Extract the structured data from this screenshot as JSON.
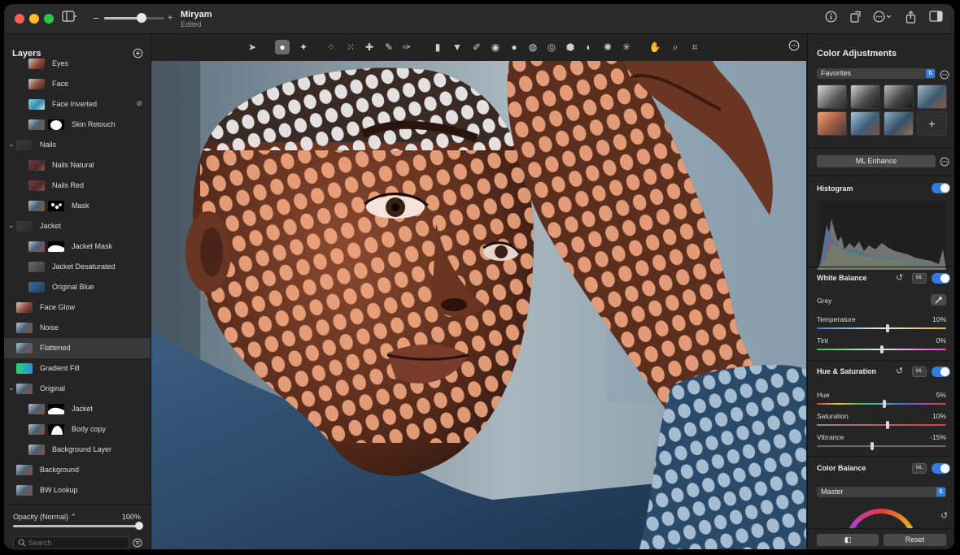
{
  "window": {
    "title": "Miryam",
    "subtitle": "Edited",
    "zoom_minus": "−",
    "zoom_plus": "+",
    "zoom_level": 0.62
  },
  "layers_panel": {
    "title": "Layers",
    "items": [
      {
        "name": "Eyes",
        "indent": 1,
        "thumb": "face",
        "mask": null,
        "chevron": false
      },
      {
        "name": "Face",
        "indent": 1,
        "thumb": "face",
        "mask": null,
        "chevron": false
      },
      {
        "name": "Face Inverted",
        "indent": 1,
        "thumb": "inverted",
        "mask": null,
        "chevron": false,
        "badge": "eye-slash-icon"
      },
      {
        "name": "Skin Retouch",
        "indent": 1,
        "thumb": "photo",
        "mask": "blob",
        "chevron": false
      },
      {
        "name": "Nails",
        "indent": 0,
        "thumb": "dark",
        "mask": null,
        "chevron": true
      },
      {
        "name": "Nails Natural",
        "indent": 1,
        "thumb": "red",
        "mask": null,
        "chevron": false
      },
      {
        "name": "Nails Red",
        "indent": 1,
        "thumb": "red",
        "mask": null,
        "chevron": false
      },
      {
        "name": "Mask",
        "indent": 1,
        "thumb": "photo",
        "mask": "dots",
        "chevron": false
      },
      {
        "name": "Jacket",
        "indent": 0,
        "thumb": "dark",
        "mask": null,
        "chevron": true
      },
      {
        "name": "Jacket Mask",
        "indent": 1,
        "thumb": "photo",
        "mask": "hill",
        "chevron": false
      },
      {
        "name": "Jacket Desaturated",
        "indent": 1,
        "thumb": "gray",
        "mask": null,
        "chevron": false
      },
      {
        "name": "Original Blue",
        "indent": 1,
        "thumb": "blue",
        "mask": null,
        "chevron": false
      },
      {
        "name": "Face Glow",
        "indent": 0,
        "thumb": "face",
        "mask": null,
        "chevron": false
      },
      {
        "name": "Noise",
        "indent": 0,
        "thumb": "photo",
        "mask": null,
        "chevron": false
      },
      {
        "name": "Flattened",
        "indent": 0,
        "thumb": "photo",
        "mask": null,
        "chevron": false,
        "selected": true
      },
      {
        "name": "Gradient Fill",
        "indent": 0,
        "thumb": "gradient",
        "mask": null,
        "chevron": false
      },
      {
        "name": "Original",
        "indent": 0,
        "thumb": "photo",
        "mask": null,
        "chevron": true
      },
      {
        "name": "Jacket",
        "indent": 1,
        "thumb": "photo",
        "mask": "hill",
        "chevron": false
      },
      {
        "name": "Body copy",
        "indent": 1,
        "thumb": "photo",
        "mask": "body",
        "chevron": false
      },
      {
        "name": "Background Layer",
        "indent": 1,
        "thumb": "photo",
        "mask": null,
        "chevron": false
      },
      {
        "name": "Background",
        "indent": 0,
        "thumb": "photo",
        "mask": null,
        "chevron": false
      },
      {
        "name": "BW Lookup",
        "indent": 0,
        "thumb": "photo",
        "mask": null,
        "chevron": false
      }
    ],
    "opacity_label": "Opacity (Normal) ⌃",
    "opacity_value": "100%",
    "opacity_fraction": 1.0,
    "search_placeholder": "Search"
  },
  "toolbar": {
    "tools": [
      {
        "name": "arrange-tool",
        "icon": "pointer-icon",
        "glyph": "➤",
        "active": false
      },
      {
        "name": "quick-selection-tool",
        "icon": "selection-brush-icon",
        "glyph": "●",
        "active": true
      },
      {
        "name": "magic-tool",
        "icon": "sparkle-icon",
        "glyph": "✦",
        "active": false
      },
      {
        "name": "retouch-tool",
        "icon": "dots-brush-icon",
        "glyph": "⁘",
        "active": false
      },
      {
        "name": "repair-tool",
        "icon": "scatter-icon",
        "glyph": "⁙",
        "active": false
      },
      {
        "name": "clone-tool",
        "icon": "band-aid-icon",
        "glyph": "✚",
        "active": false
      },
      {
        "name": "smudge-tool",
        "icon": "eraser-icon",
        "glyph": "✎",
        "active": false
      },
      {
        "name": "paint-tool",
        "icon": "brush-icon",
        "glyph": "✑",
        "active": false
      },
      {
        "name": "gradient-tool",
        "icon": "gradient-icon",
        "glyph": "▮",
        "active": false
      },
      {
        "name": "fill-tool",
        "icon": "bucket-icon",
        "glyph": "▼",
        "active": false
      },
      {
        "name": "pencil-tool",
        "icon": "pencil-icon",
        "glyph": "✐",
        "active": false
      },
      {
        "name": "sponge-tool",
        "icon": "sponge-icon",
        "glyph": "◉",
        "active": false
      },
      {
        "name": "darken-tool",
        "icon": "dark-circle-icon",
        "glyph": "●",
        "active": false
      },
      {
        "name": "blur-tool",
        "icon": "blur-icon",
        "glyph": "◍",
        "active": false
      },
      {
        "name": "sharpen-tool",
        "icon": "sharpen-icon",
        "glyph": "◎",
        "active": false
      },
      {
        "name": "adjust-tool",
        "icon": "shield-icon",
        "glyph": "⬢",
        "active": false
      },
      {
        "name": "contrast-tool",
        "icon": "half-circle-icon",
        "glyph": "◐",
        "active": false
      },
      {
        "name": "light-tool",
        "icon": "sun-icon",
        "glyph": "✺",
        "active": false
      },
      {
        "name": "noise-tool",
        "icon": "noise-icon",
        "glyph": "✳",
        "active": false
      },
      {
        "name": "hand-tool",
        "icon": "hand-icon",
        "glyph": "✋",
        "active": false
      },
      {
        "name": "zoom-tool",
        "icon": "magnifier-icon",
        "glyph": "⌕",
        "active": false
      },
      {
        "name": "crop-tool",
        "icon": "crop-icon",
        "glyph": "⌗",
        "active": false
      }
    ],
    "more": "⋯"
  },
  "adjustments": {
    "title": "Color Adjustments",
    "preset_select": "Favorites",
    "preset_add": "+",
    "ml_enhance": "ML Enhance",
    "histogram": {
      "title": "Histogram"
    },
    "white_balance": {
      "title": "White Balance",
      "ml": "ML",
      "grey_label": "Grey",
      "temperature_label": "Temperature",
      "temperature_value": "10%",
      "temperature_pos": 0.55,
      "tint_label": "Tint",
      "tint_value": "0%",
      "tint_pos": 0.5
    },
    "hue_saturation": {
      "title": "Hue & Saturation",
      "ml": "ML",
      "hue_label": "Hue",
      "hue_value": "5%",
      "hue_pos": 0.52,
      "saturation_label": "Saturation",
      "saturation_value": "10%",
      "saturation_pos": 0.55,
      "vibrance_label": "Vibrance",
      "vibrance_value": "-15%",
      "vibrance_pos": 0.43
    },
    "color_balance": {
      "title": "Color Balance",
      "ml": "ML",
      "mode_select": "Master"
    },
    "footer": {
      "compare_label": "◧",
      "reset_label": "Reset"
    }
  },
  "colors": {
    "accent": "#2f7de1",
    "panel": "#252525",
    "titlebar": "#2a2a2a"
  }
}
